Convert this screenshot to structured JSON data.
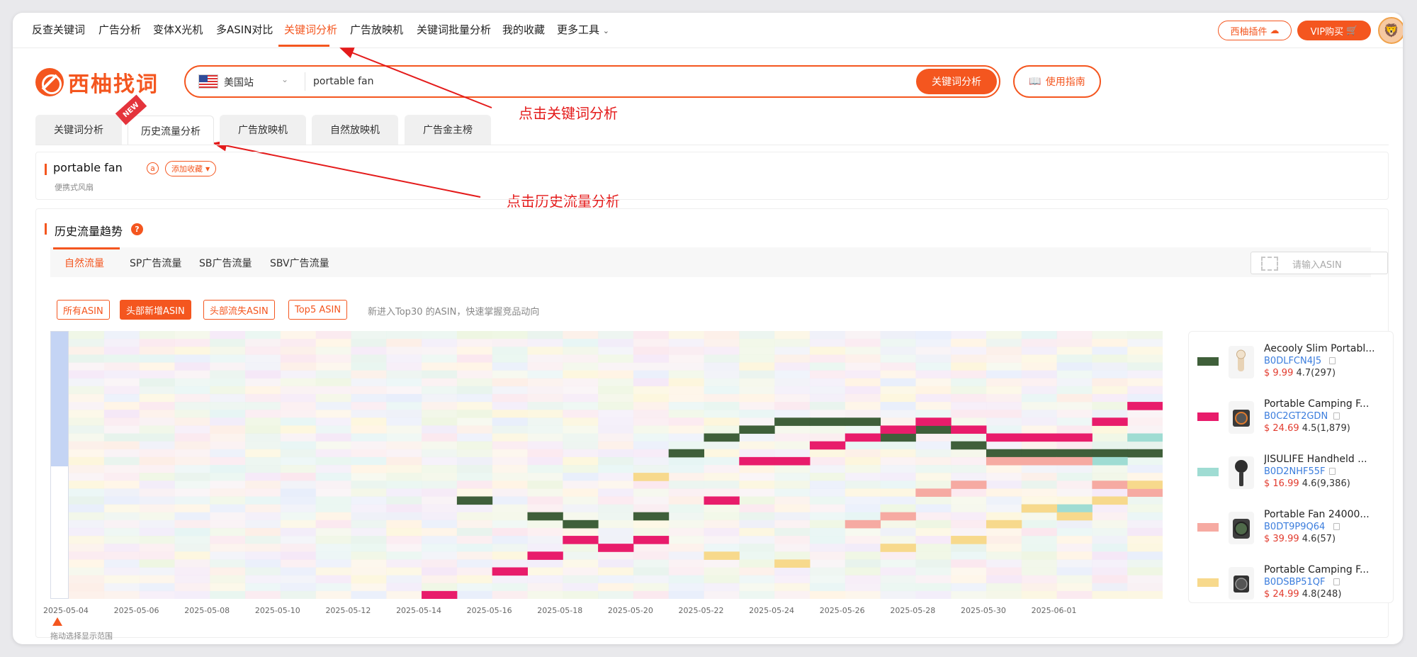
{
  "topnav": {
    "items": [
      "反查关键词",
      "广告分析",
      "变体X光机",
      "多ASIN对比",
      "关键词分析",
      "广告放映机",
      "关键词批量分析",
      "我的收藏",
      "更多工具"
    ],
    "active_index": 4,
    "plugin_label": "西柚插件",
    "vip_label": "VIP购买"
  },
  "brand": {
    "name": "西柚找词",
    "color": "#f4561f"
  },
  "search": {
    "station": "美国站",
    "query": "portable fan",
    "button": "关键词分析",
    "guide_button": "使用指南"
  },
  "annotations": {
    "click_keyword": "点击关键词分析",
    "click_history": "点击历史流量分析"
  },
  "main_tabs": {
    "items": [
      "关键词分析",
      "历史流量分析",
      "广告放映机",
      "自然放映机",
      "广告金主榜"
    ],
    "active_index": 1,
    "new_badge": "NEW"
  },
  "keyword": {
    "title": "portable fan",
    "badge": "a",
    "fav_button": "添加收藏",
    "translation": "便携式风扇"
  },
  "trend": {
    "title": "历史流量趋势",
    "help_icon": "?",
    "tabs": [
      "自然流量",
      "SP广告流量",
      "SB广告流量",
      "SBV广告流量"
    ],
    "active_tab": 0,
    "asin_placeholder": "请输入ASIN",
    "filters": [
      "所有ASIN",
      "头部新增ASIN",
      "头部流失ASIN",
      "Top5 ASIN"
    ],
    "active_filter": 1,
    "hint": "新进入Top30 的ASIN，快速掌握竞品动向",
    "drag_hint": "拖动选择显示范围"
  },
  "chart_data": {
    "type": "heatmap",
    "x_tick_labels": [
      "2025-05-04",
      "2025-05-06",
      "2025-05-08",
      "2025-05-10",
      "2025-05-12",
      "2025-05-14",
      "2025-05-16",
      "2025-05-18",
      "2025-05-20",
      "2025-05-22",
      "2025-05-24",
      "2025-05-26",
      "2025-05-28",
      "2025-05-30",
      "2025-06-01"
    ],
    "x_start": "2025-05-04",
    "x_end": "2025-06-03",
    "y_meaning": "rank 1 (top) to 34 (bottom)",
    "series": [
      {
        "name": "Aecooly Slim Portable Fan",
        "color": "#3f5f3a",
        "points": [
          [
            "2025-05-15",
            22
          ],
          [
            "2025-05-17",
            24
          ],
          [
            "2025-05-18",
            25
          ],
          [
            "2025-05-20",
            24
          ],
          [
            "2025-05-21",
            16
          ],
          [
            "2025-05-22",
            14
          ],
          [
            "2025-05-23",
            13
          ],
          [
            "2025-05-24",
            12
          ],
          [
            "2025-05-25",
            12
          ],
          [
            "2025-05-26",
            12
          ],
          [
            "2025-05-27",
            14
          ],
          [
            "2025-05-28",
            13
          ],
          [
            "2025-05-29",
            15
          ],
          [
            "2025-05-30",
            16
          ],
          [
            "2025-05-31",
            16
          ],
          [
            "2025-06-01",
            16
          ],
          [
            "2025-06-02",
            16
          ],
          [
            "2025-06-03",
            16
          ]
        ]
      },
      {
        "name": "Portable Camping Fan",
        "color": "#e81c6b",
        "points": [
          [
            "2025-05-14",
            34
          ],
          [
            "2025-05-16",
            31
          ],
          [
            "2025-05-17",
            29
          ],
          [
            "2025-05-18",
            27
          ],
          [
            "2025-05-19",
            28
          ],
          [
            "2025-05-20",
            27
          ],
          [
            "2025-05-22",
            22
          ],
          [
            "2025-05-23",
            17
          ],
          [
            "2025-05-24",
            17
          ],
          [
            "2025-05-25",
            15
          ],
          [
            "2025-05-26",
            14
          ],
          [
            "2025-05-27",
            13
          ],
          [
            "2025-05-28",
            12
          ],
          [
            "2025-05-29",
            13
          ],
          [
            "2025-05-30",
            14
          ],
          [
            "2025-05-31",
            14
          ],
          [
            "2025-06-01",
            14
          ],
          [
            "2025-06-02",
            12
          ],
          [
            "2025-06-03",
            10
          ]
        ]
      },
      {
        "name": "JISULIFE Handheld Fan",
        "color": "#9fdcd3",
        "points": [
          [
            "2025-05-31",
            23
          ],
          [
            "2025-06-01",
            23
          ],
          [
            "2025-06-02",
            17
          ],
          [
            "2025-06-03",
            14
          ]
        ]
      },
      {
        "name": "Portable Fan 24000mAh",
        "color": "#f6aaa2",
        "points": [
          [
            "2025-05-26",
            25
          ],
          [
            "2025-05-27",
            24
          ],
          [
            "2025-05-28",
            21
          ],
          [
            "2025-05-29",
            20
          ],
          [
            "2025-05-30",
            17
          ],
          [
            "2025-05-31",
            17
          ],
          [
            "2025-06-01",
            17
          ],
          [
            "2025-06-02",
            20
          ],
          [
            "2025-06-03",
            21
          ]
        ]
      },
      {
        "name": "Portable Camping Fan",
        "color": "#f7d98c",
        "points": [
          [
            "2025-05-20",
            19
          ],
          [
            "2025-05-22",
            29
          ],
          [
            "2025-05-24",
            30
          ],
          [
            "2025-05-27",
            28
          ],
          [
            "2025-05-29",
            27
          ],
          [
            "2025-05-30",
            25
          ],
          [
            "2025-05-31",
            23
          ],
          [
            "2025-06-01",
            24
          ],
          [
            "2025-06-02",
            22
          ],
          [
            "2025-06-03",
            20
          ]
        ]
      }
    ]
  },
  "legend": {
    "items": [
      {
        "name": "Aecooly Slim Portabl...",
        "asin": "B0DLFCN4J5",
        "price": "$ 9.99",
        "rating": "4.7(297)",
        "color": "#3f5f3a"
      },
      {
        "name": "Portable Camping F...",
        "asin": "B0C2GT2GDN",
        "price": "$ 24.69",
        "rating": "4.5(1,879)",
        "color": "#e81c6b"
      },
      {
        "name": "JISULIFE Handheld ...",
        "asin": "B0D2NHF55F",
        "price": "$ 16.99",
        "rating": "4.6(9,386)",
        "color": "#9fdcd3"
      },
      {
        "name": "Portable Fan 24000...",
        "asin": "B0DT9P9Q64",
        "price": "$ 39.99",
        "rating": "4.6(57)",
        "color": "#f6aaa2"
      },
      {
        "name": "Portable Camping F...",
        "asin": "B0DSBP51QF",
        "price": "$ 24.99",
        "rating": "4.8(248)",
        "color": "#f7d98c"
      }
    ]
  }
}
